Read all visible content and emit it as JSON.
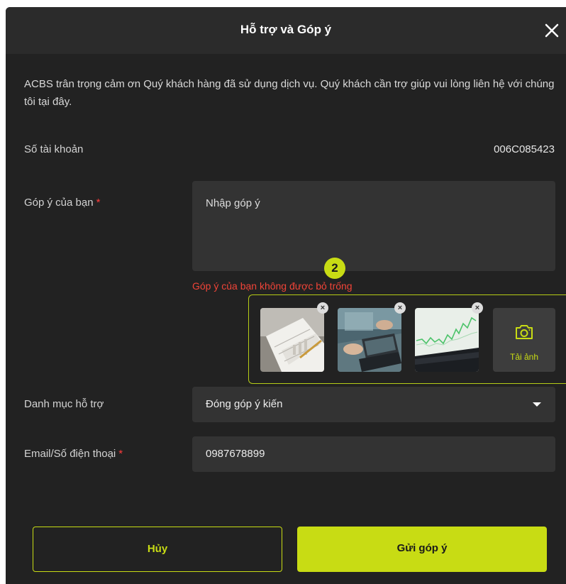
{
  "dialog": {
    "title": "Hỗ trợ và Góp ý",
    "intro": "ACBS trân trọng cảm ơn Quý khách hàng đã sử dụng dịch vụ. Quý khách cần trợ giúp vui lòng liên hệ với chúng tôi tại đây."
  },
  "account": {
    "label": "Số tài khoản",
    "value": "006C085423"
  },
  "feedback": {
    "label": "Góp ý của bạn",
    "required_mark": "*",
    "placeholder": "Nhập góp ý",
    "error": "Góp ý của bạn không được bỏ trống"
  },
  "step_badge": "2",
  "images": {
    "thumbnails": [
      {
        "name": "paper-chart-photo"
      },
      {
        "name": "laptop-meeting-photo"
      },
      {
        "name": "stock-chart-screen-photo"
      }
    ],
    "remove_glyph": "×",
    "upload_label": "Tải ảnh"
  },
  "category": {
    "label": "Danh mục hỗ trợ",
    "selected": "Đóng góp ý kiến"
  },
  "contact": {
    "label": "Email/Số điện thoại",
    "required_mark": "*",
    "value": "0987678899"
  },
  "actions": {
    "cancel": "Hủy",
    "submit": "Gửi góp ý"
  },
  "colors": {
    "accent": "#c8dc14",
    "background": "#222222",
    "field": "#333333",
    "error": "#f04438"
  }
}
